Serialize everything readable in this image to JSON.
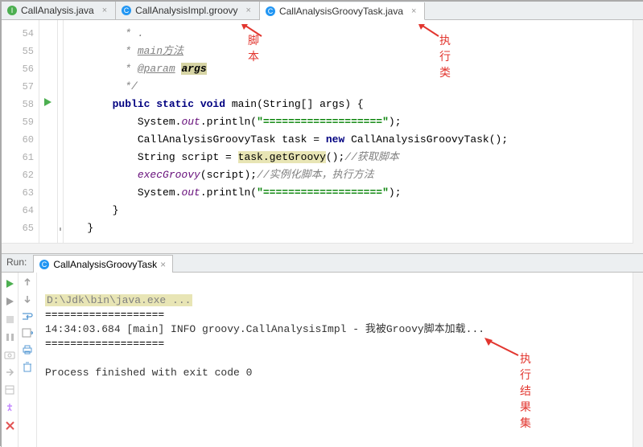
{
  "tabs": [
    {
      "label": "CallAnalysis.java",
      "icon": "interface",
      "active": false
    },
    {
      "label": "CallAnalysisImpl.groovy",
      "icon": "class",
      "active": false
    },
    {
      "label": "CallAnalysisGroovyTask.java",
      "icon": "class",
      "active": true
    }
  ],
  "annotations": {
    "script": "脚本",
    "execClass": "执行类",
    "resultSet": "执行结果集"
  },
  "gutter": {
    "start": 54,
    "end": 65
  },
  "code": {
    "54": {
      "indent": 8,
      "segments": [
        {
          "t": " * .",
          "cls": "c-cmt"
        }
      ]
    },
    "55": {
      "indent": 8,
      "segments": [
        {
          "t": " * ",
          "cls": "c-cmt"
        },
        {
          "t": "main方法",
          "cls": "c-cmt underline"
        }
      ]
    },
    "56": {
      "indent": 8,
      "segments": [
        {
          "t": " * ",
          "cls": "c-cmt"
        },
        {
          "t": "@param",
          "cls": "c-cmt underline"
        },
        {
          "t": " ",
          "cls": "c-cmt"
        },
        {
          "t": "args",
          "cls": "hl-param"
        }
      ]
    },
    "57": {
      "indent": 8,
      "segments": [
        {
          "t": " */",
          "cls": "c-cmt"
        }
      ]
    },
    "58": {
      "indent": 7,
      "segments": [
        {
          "t": "public ",
          "cls": "c-kw"
        },
        {
          "t": "static ",
          "cls": "c-kw"
        },
        {
          "t": "void ",
          "cls": "c-kw"
        },
        {
          "t": "main",
          "cls": "c-cls"
        },
        {
          "t": "(String[] args) {",
          "cls": ""
        }
      ]
    },
    "59": {
      "indent": 11,
      "segments": [
        {
          "t": "System.",
          "cls": ""
        },
        {
          "t": "out",
          "cls": "c-stat"
        },
        {
          "t": ".println(",
          "cls": ""
        },
        {
          "t": "\"===================\"",
          "cls": "c-str"
        },
        {
          "t": ");",
          "cls": ""
        }
      ]
    },
    "60": {
      "indent": 11,
      "segments": [
        {
          "t": "CallAnalysisGroovyTask task = ",
          "cls": ""
        },
        {
          "t": "new ",
          "cls": "c-new"
        },
        {
          "t": "CallAnalysisGroovyTask();",
          "cls": ""
        }
      ]
    },
    "61": {
      "indent": 11,
      "segments": [
        {
          "t": "String script = ",
          "cls": ""
        },
        {
          "t": "task.getGroovy",
          "cls": "hl"
        },
        {
          "t": "();",
          "cls": ""
        },
        {
          "t": "//获取脚本",
          "cls": "c-cmt"
        }
      ]
    },
    "62": {
      "indent": 11,
      "segments": [
        {
          "t": "execGroovy",
          "cls": "c-stat"
        },
        {
          "t": "(script);",
          "cls": ""
        },
        {
          "t": "//实例化脚本，执行方法",
          "cls": "c-cmt"
        }
      ]
    },
    "63": {
      "indent": 11,
      "segments": [
        {
          "t": "System.",
          "cls": ""
        },
        {
          "t": "out",
          "cls": "c-stat"
        },
        {
          "t": ".println(",
          "cls": ""
        },
        {
          "t": "\"===================\"",
          "cls": "c-str"
        },
        {
          "t": ");",
          "cls": ""
        }
      ]
    },
    "64": {
      "indent": 7,
      "segments": [
        {
          "t": "}",
          "cls": ""
        }
      ]
    },
    "65": {
      "indent": 3,
      "segments": [
        {
          "t": "}",
          "cls": ""
        }
      ]
    }
  },
  "run": {
    "label": "Run:",
    "tab": "CallAnalysisGroovyTask",
    "exeLine": "D:\\Jdk\\bin\\java.exe ...",
    "sep": "===================",
    "logLine": "14:34:03.684 [main] INFO groovy.CallAnalysisImpl - 我被Groovy脚本加载...",
    "finished": "Process finished with exit code 0"
  }
}
